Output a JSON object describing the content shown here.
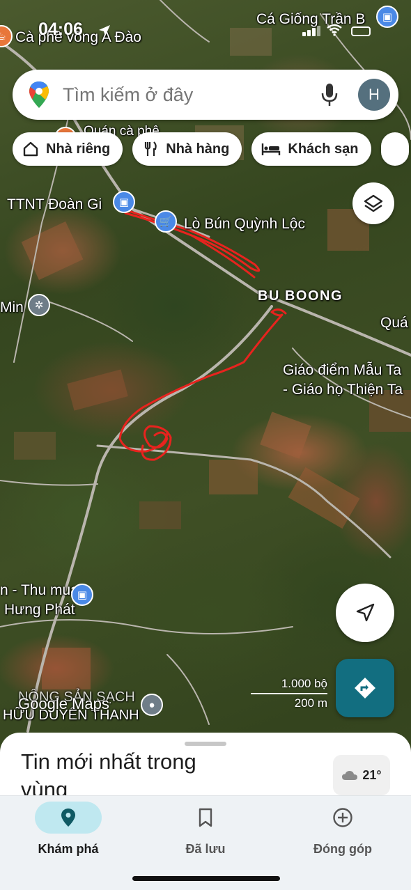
{
  "status_bar": {
    "time": "04:06"
  },
  "search": {
    "placeholder": "Tìm kiếm ở đây",
    "avatar_letter": "H"
  },
  "chips": [
    {
      "label": "Nhà riêng",
      "icon": "home-icon"
    },
    {
      "label": "Nhà hàng",
      "icon": "restaurant-icon"
    },
    {
      "label": "Khách sạn",
      "icon": "hotel-icon"
    }
  ],
  "map_labels": {
    "ca_phe": "Cà phê võng A Đào",
    "ca_giong": "Cá Giống Trần B",
    "quan_ca_phe": "Quán cà phê",
    "ttnt": "TTNT Đoàn Gi",
    "lo_bun": "Lò Bún Quỳnh Lộc",
    "bu_boong": "BU BOONG",
    "min": "Min",
    "qua": "Quá",
    "giao_diem_1": "Giáo điểm Mẫu Ta",
    "giao_diem_2": "- Giáo họ Thiện Ta",
    "thu_mua_1": "n - Thu mua",
    "thu_mua_2": "Hưng Phát",
    "nong_san_1": "NÔNG SẢN SẠCH",
    "nong_san_2": "HỮU DUYÊN THANH"
  },
  "scale": {
    "imperial": "1.000 bộ",
    "metric": "200 m"
  },
  "watermark": "Google Maps",
  "sheet": {
    "title": "Tin mới nhất trong vùng",
    "temperature": "21°"
  },
  "nav": [
    {
      "label": "Khám phá",
      "icon": "explore-pin-icon",
      "active": true
    },
    {
      "label": "Đã lưu",
      "icon": "bookmark-icon",
      "active": false
    },
    {
      "label": "Đóng góp",
      "icon": "add-circle-icon",
      "active": false
    }
  ],
  "colors": {
    "accent": "#126e80",
    "active_pill": "#bfe8f0",
    "drawn_route": "#e8231e"
  }
}
